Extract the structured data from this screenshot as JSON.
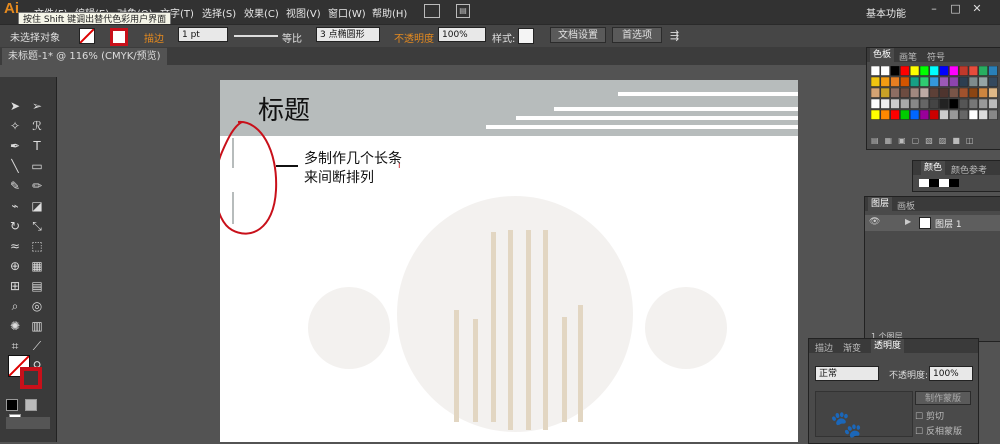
{
  "app": {
    "logo": "Ai",
    "menus": [
      "文件(F)",
      "编辑(E)",
      "对象(O)",
      "文字(T)",
      "选择(S)",
      "效果(C)",
      "视图(V)",
      "窗口(W)",
      "帮助(H)"
    ],
    "tooltip": "按住 Shift 键调出替代色彩用户界面",
    "workspace": "基本功能",
    "window_buttons": [
      "–",
      "□",
      "✕"
    ]
  },
  "control_bar": {
    "selection": "未选择对象",
    "stroke_label": "描边",
    "stroke_weight": "1 pt",
    "stroke_profile": "等比",
    "brush": "3 点椭圆形",
    "opacity_label": "不透明度",
    "opacity_value": "100%",
    "style_label": "样式:",
    "doc_settings": "文档设置",
    "preferences": "首选项"
  },
  "document_tab": "未标题-1* @ 116% (CMYK/预览)",
  "artboard": {
    "title": "标题",
    "annotation": "多制作几个长条来间断排列"
  },
  "swatches_panel": {
    "tabs": [
      "色板",
      "画笔",
      "符号"
    ]
  },
  "color_panel": {
    "tabs": [
      "颜色",
      "颜色参考"
    ]
  },
  "layers_panel": {
    "tabs": [
      "图层",
      "画板"
    ],
    "layer_name": "图层 1",
    "footer": "1 个图层"
  },
  "transparency_panel": {
    "tabs": [
      "描边",
      "渐变",
      "透明度"
    ],
    "blend_mode": "正常",
    "opacity_label": "不透明度:",
    "opacity_value": "100%",
    "make_mask": "制作蒙版",
    "clip": "剪切",
    "invert_mask": "反相蒙版"
  },
  "colors": {
    "accent_orange": "#e58a1f",
    "circle_fill": "#f3f1ef",
    "bar_fill": "#e2d6c2",
    "header_band": "#b7bcbc",
    "annotation_red": "#c8101a"
  }
}
